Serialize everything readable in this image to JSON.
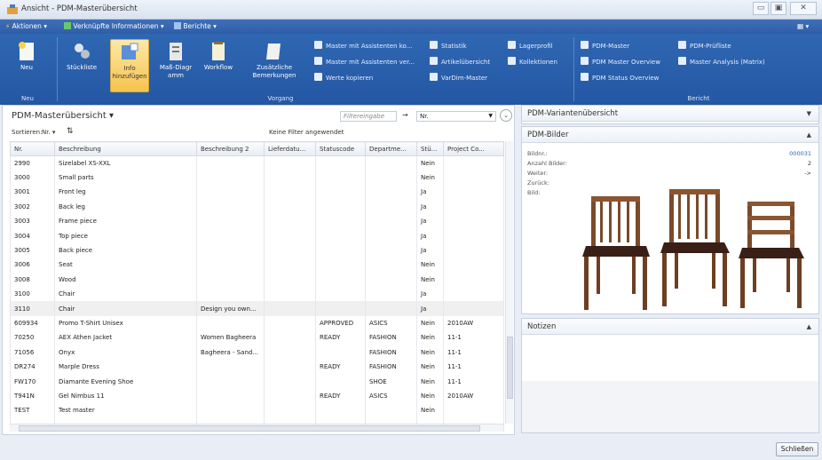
{
  "window": {
    "title": "Ansicht - PDM-Masterübersicht",
    "controls": [
      "▭",
      "▣",
      "✕"
    ]
  },
  "menubar": {
    "items": [
      {
        "label": "Aktionen ▾"
      },
      {
        "label": "Verknüpfte Informationen ▾"
      },
      {
        "label": "Berichte ▾"
      }
    ]
  },
  "ribbon": {
    "groups": {
      "neu": "Neu",
      "vorgang": "Vorgang",
      "bericht": "Bericht"
    },
    "big_buttons": [
      {
        "label": "Neu"
      },
      {
        "label": "Stückliste"
      },
      {
        "label": "Info hinzufügen"
      },
      {
        "label": "Maß-Diagr amm"
      },
      {
        "label": "Workflow"
      },
      {
        "label": "Zusätzliche Bemerkungen"
      }
    ],
    "small_col1": [
      "Master mit Assistenten ko...",
      "Master mit Assistenten ver...",
      "Werte kopieren"
    ],
    "small_col2": [
      "Statistik",
      "Artikelübersicht",
      "VarDim-Master"
    ],
    "small_col3": [
      "Lagerprofil",
      "Kollektionen"
    ],
    "small_col4": [
      "PDM-Master",
      "PDM Master Overview",
      "PDM Status Overview"
    ],
    "small_col5": [
      "PDM-Prüfliste",
      "Master Analysis (Matrix)"
    ]
  },
  "list": {
    "title": "PDM-Masterübersicht ▾",
    "filter_placeholder": "Filtereingabe",
    "filter_field": "Nr.",
    "sort_label": "Sortieren:",
    "sort_field": "Nr. ▾",
    "no_filter": "Keine Filter angewendet",
    "columns": [
      "Nr.",
      "Beschreibung",
      "Beschreibung 2",
      "Lieferdatu...",
      "Statuscode",
      "Departme...",
      "Stü...",
      "Project Co..."
    ],
    "rows": [
      [
        "2990",
        "Sizelabel XS-XXL",
        "",
        "",
        "",
        "",
        "Nein",
        ""
      ],
      [
        "3000",
        "Small parts",
        "",
        "",
        "",
        "",
        "Nein",
        ""
      ],
      [
        "3001",
        "Front leg",
        "",
        "",
        "",
        "",
        "Ja",
        ""
      ],
      [
        "3002",
        "Back leg",
        "",
        "",
        "",
        "",
        "Ja",
        ""
      ],
      [
        "3003",
        "Frame piece",
        "",
        "",
        "",
        "",
        "Ja",
        ""
      ],
      [
        "3004",
        "Top piece",
        "",
        "",
        "",
        "",
        "Ja",
        ""
      ],
      [
        "3005",
        "Back piece",
        "",
        "",
        "",
        "",
        "Ja",
        ""
      ],
      [
        "3006",
        "Seat",
        "",
        "",
        "",
        "",
        "Nein",
        ""
      ],
      [
        "3008",
        "Wood",
        "",
        "",
        "",
        "",
        "Nein",
        ""
      ],
      [
        "3100",
        "Chair",
        "",
        "",
        "",
        "",
        "Ja",
        ""
      ],
      [
        "3110",
        "Chair",
        "Design you own...",
        "",
        "",
        "",
        "Ja",
        ""
      ],
      [
        "609934",
        "Promo T-Shirt Unisex",
        "",
        "",
        "APPROVED",
        "ASICS",
        "Nein",
        "2010AW"
      ],
      [
        "70250",
        "AEX Athen Jacket",
        "Women Bagheera",
        "",
        "READY",
        "FASHION",
        "Nein",
        "11-1"
      ],
      [
        "71056",
        "Onyx",
        "Bagheera - Sand...",
        "",
        "",
        "FASHION",
        "Nein",
        "11-1"
      ],
      [
        "DR274",
        "Marple Dress",
        "",
        "",
        "READY",
        "FASHION",
        "Nein",
        "11-1"
      ],
      [
        "FW170",
        "Diamante Evening Shoe",
        "",
        "",
        "",
        "SHOE",
        "Nein",
        "11-1"
      ],
      [
        "T941N",
        "Gel Nimbus 11",
        "",
        "",
        "READY",
        "ASICS",
        "Nein",
        "2010AW"
      ],
      [
        "TEST",
        "Test master",
        "",
        "",
        "",
        "",
        "Nein",
        ""
      ],
      [
        "",
        "",
        "",
        "",
        "",
        "",
        "",
        ""
      ]
    ]
  },
  "factbox_varianten": {
    "title": "PDM-Variantenübersicht"
  },
  "factbox_bilder": {
    "title": "PDM-Bilder",
    "fields": [
      {
        "label": "Bildnr.:",
        "value": "000031"
      },
      {
        "label": "Anzahl Bilder:",
        "value": "2"
      },
      {
        "label": "Weiter:",
        "value": "->"
      },
      {
        "label": "Zurück:",
        "value": ""
      },
      {
        "label": "Bild:",
        "value": ""
      }
    ]
  },
  "factbox_notizen": {
    "title": "Notizen"
  },
  "footer": {
    "close_label": "Schließen"
  },
  "colors": {
    "ribbon": "#2457a3",
    "accent": "#f6c34c",
    "chair_wood": "#7a4a2a",
    "chair_seat": "#3a1f17"
  }
}
